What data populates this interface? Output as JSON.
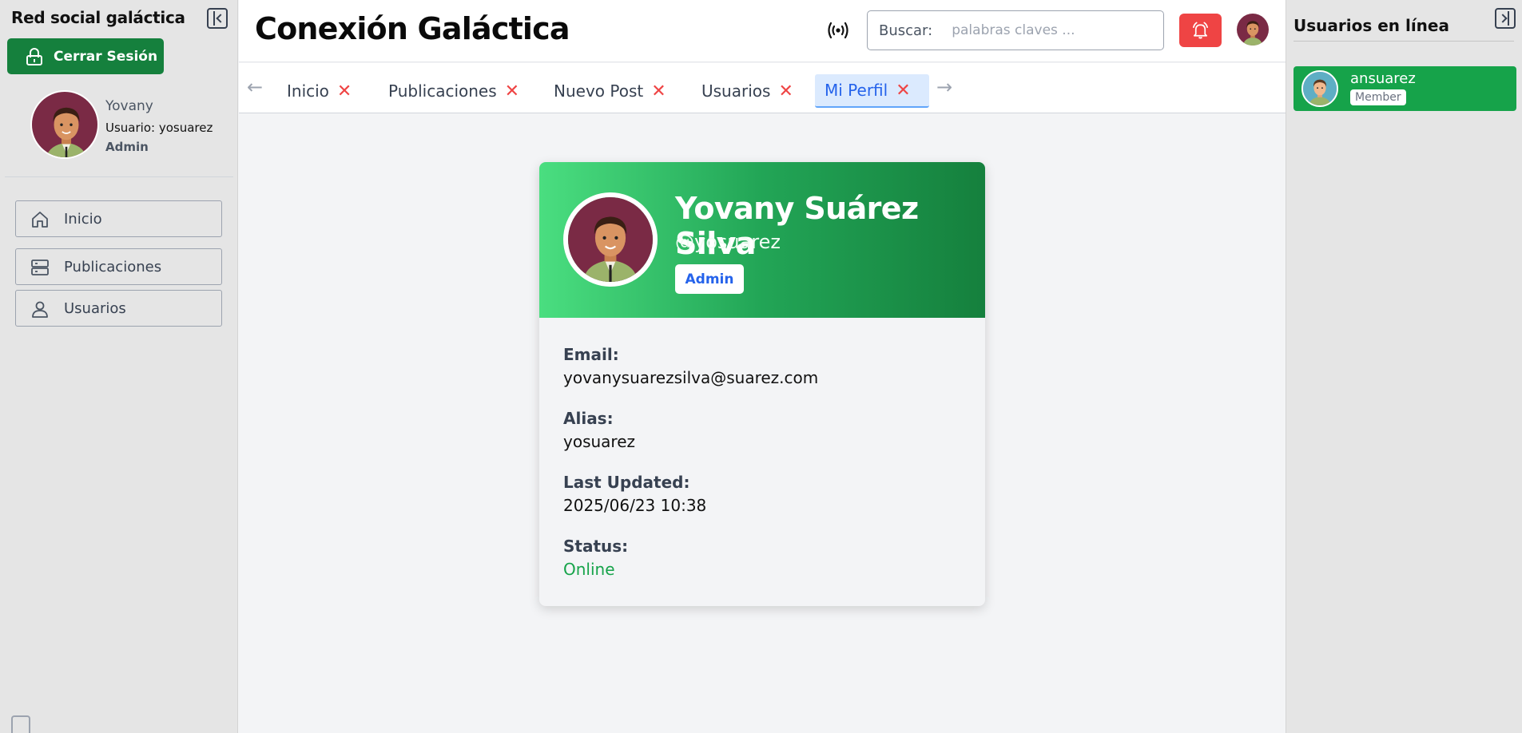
{
  "sidebar": {
    "title": "Red social galáctica",
    "logout_label": "Cerrar Sesión",
    "user": {
      "name": "Yovany",
      "username_line": "Usuario: yosuarez",
      "role": "Admin"
    },
    "nav": [
      {
        "label": "Inicio",
        "icon": "home-icon"
      },
      {
        "label": "Publicaciones",
        "icon": "server-icon"
      },
      {
        "label": "Usuarios",
        "icon": "user-icon"
      }
    ]
  },
  "header": {
    "title": "Conexión Galáctica",
    "search_label": "Buscar:",
    "search_placeholder": "palabras claves ...",
    "search_value": ""
  },
  "tabs": {
    "prev_arrow": "←",
    "next_arrow": "→",
    "close_glyph": "✕",
    "items": [
      {
        "label": "Inicio",
        "active": false
      },
      {
        "label": "Publicaciones",
        "active": false
      },
      {
        "label": "Nuevo Post",
        "active": false
      },
      {
        "label": "Usuarios",
        "active": false
      },
      {
        "label": "Mi Perfil",
        "active": true
      }
    ]
  },
  "profile": {
    "full_name": "Yovany Suárez Silva",
    "handle": "@yosuarez",
    "badge": "Admin",
    "fields": [
      {
        "label": "Email:",
        "value": "yovanysuarezsilva@suarez.com"
      },
      {
        "label": "Alias:",
        "value": "yosuarez"
      },
      {
        "label": "Last Updated:",
        "value": "2025/06/23 10:38"
      },
      {
        "label": "Status:",
        "value": "Online"
      }
    ]
  },
  "online_panel": {
    "title": "Usuarios en línea",
    "users": [
      {
        "name": "ansuarez",
        "role": "Member"
      }
    ]
  },
  "colors": {
    "primary_green": "#15803d",
    "online_green": "#16a34a",
    "alert_red": "#ef4444",
    "active_tab_blue": "#2563eb",
    "avatar_bg": "#7a2a45"
  }
}
